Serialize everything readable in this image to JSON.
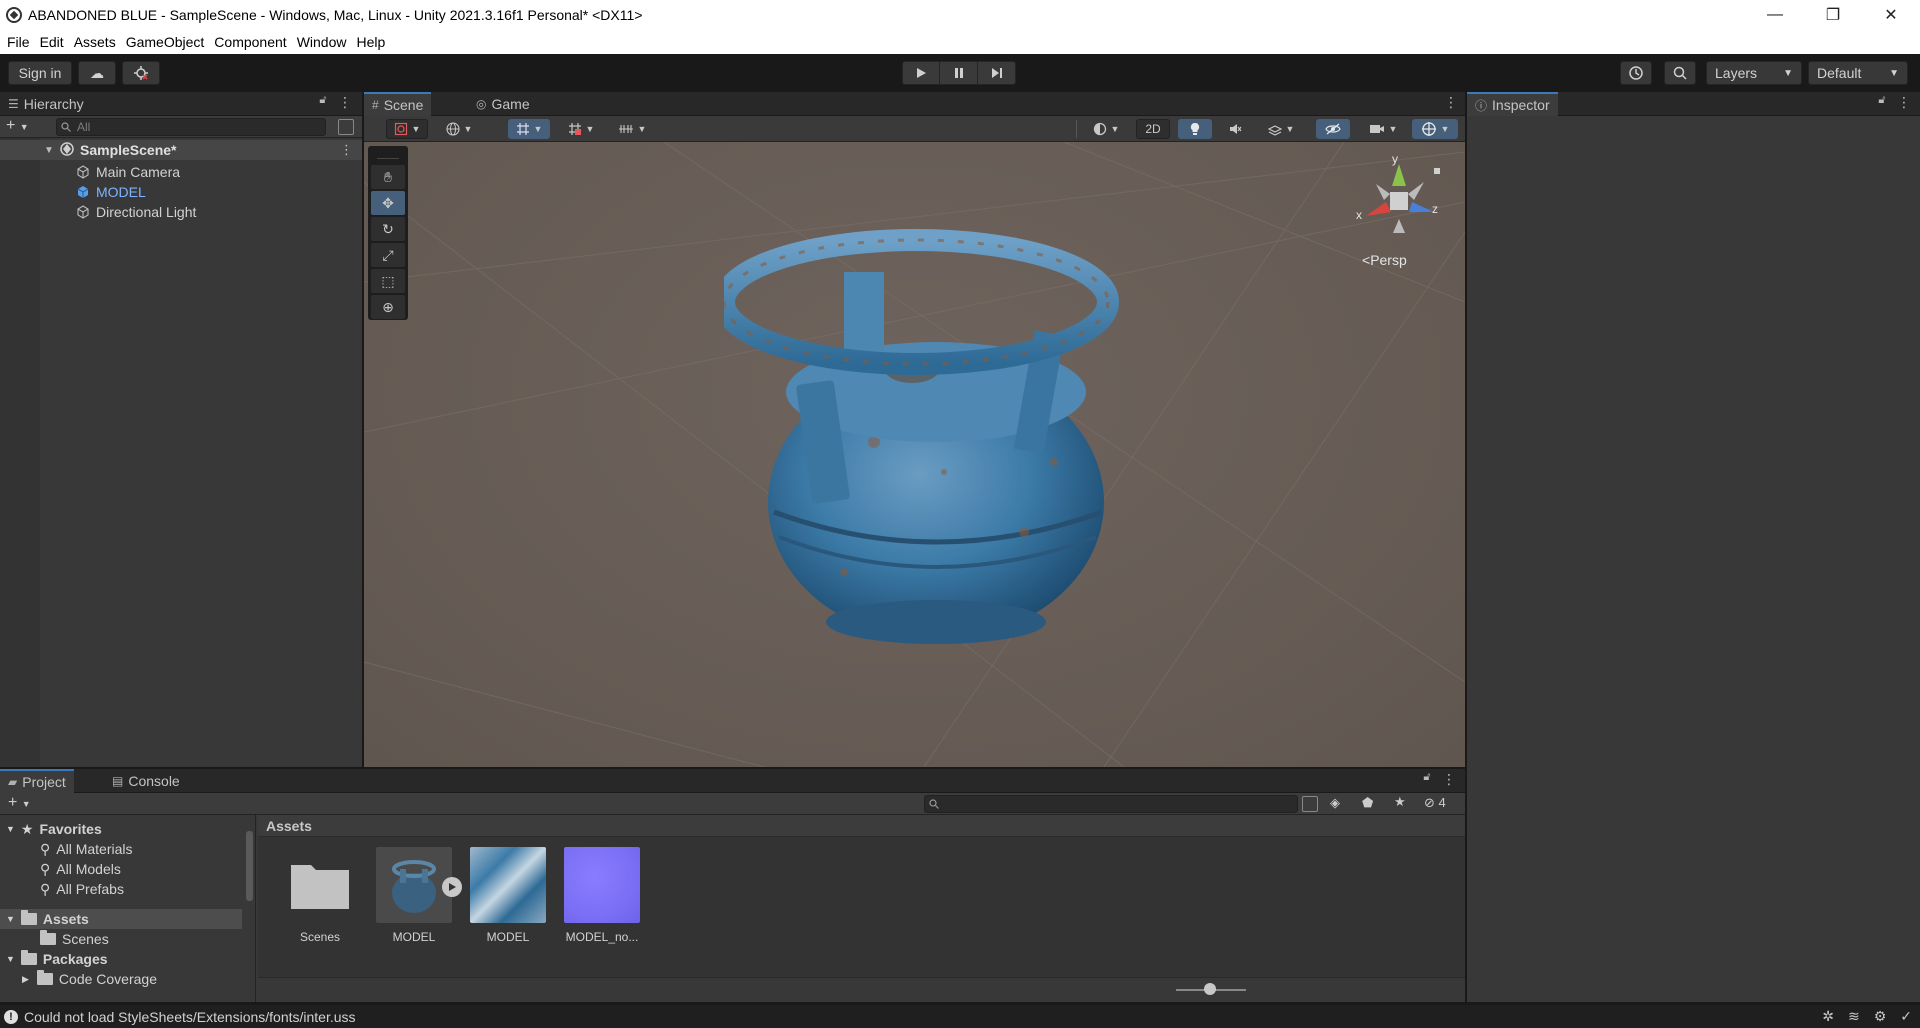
{
  "window": {
    "title": "ABANDONED BLUE - SampleScene - Windows, Mac, Linux - Unity 2021.3.16f1 Personal* <DX11>",
    "controls": {
      "minimize": "—",
      "restore": "❐",
      "close": "✕"
    }
  },
  "menu": [
    "File",
    "Edit",
    "Assets",
    "GameObject",
    "Component",
    "Window",
    "Help"
  ],
  "toolbar": {
    "sign_in": "Sign in",
    "layers": "Layers",
    "layout": "Default"
  },
  "hierarchy": {
    "tab": "Hierarchy",
    "search_placeholder": "All",
    "scene": "SampleScene*",
    "objects": [
      "Main Camera",
      "MODEL",
      "Directional Light"
    ],
    "selected_color": "#7cb4ff"
  },
  "scene": {
    "tabs": [
      "Scene",
      "Game"
    ],
    "toggle_2d": "2D",
    "gizmo": {
      "x": "x",
      "y": "y",
      "z": "z",
      "projection": "Persp"
    }
  },
  "inspector": {
    "tab": "Inspector"
  },
  "project": {
    "tabs": [
      "Project",
      "Console"
    ],
    "tree": {
      "favorites": "Favorites",
      "favorite_items": [
        "All Materials",
        "All Models",
        "All Prefabs"
      ],
      "assets": "Assets",
      "asset_items": [
        "Scenes"
      ],
      "packages": "Packages",
      "package_items": [
        "Code Coverage"
      ]
    },
    "breadcrumb": "Assets",
    "hidden_count": "4",
    "assets": [
      {
        "name": "Scenes",
        "kind": "folder-icon"
      },
      {
        "name": "MODEL",
        "kind": "model-prefab"
      },
      {
        "name": "MODEL",
        "kind": "texture-albedo"
      },
      {
        "name": "MODEL_no...",
        "kind": "texture-normal"
      }
    ]
  },
  "status": {
    "message": "Could not load StyleSheets/Extensions/fonts/inter.uss"
  },
  "colors": {
    "accent": "#3a79bb",
    "toggle_on": "#46607c",
    "scene_bg": "#675d56",
    "tank_blue": "#3c7ba8"
  }
}
